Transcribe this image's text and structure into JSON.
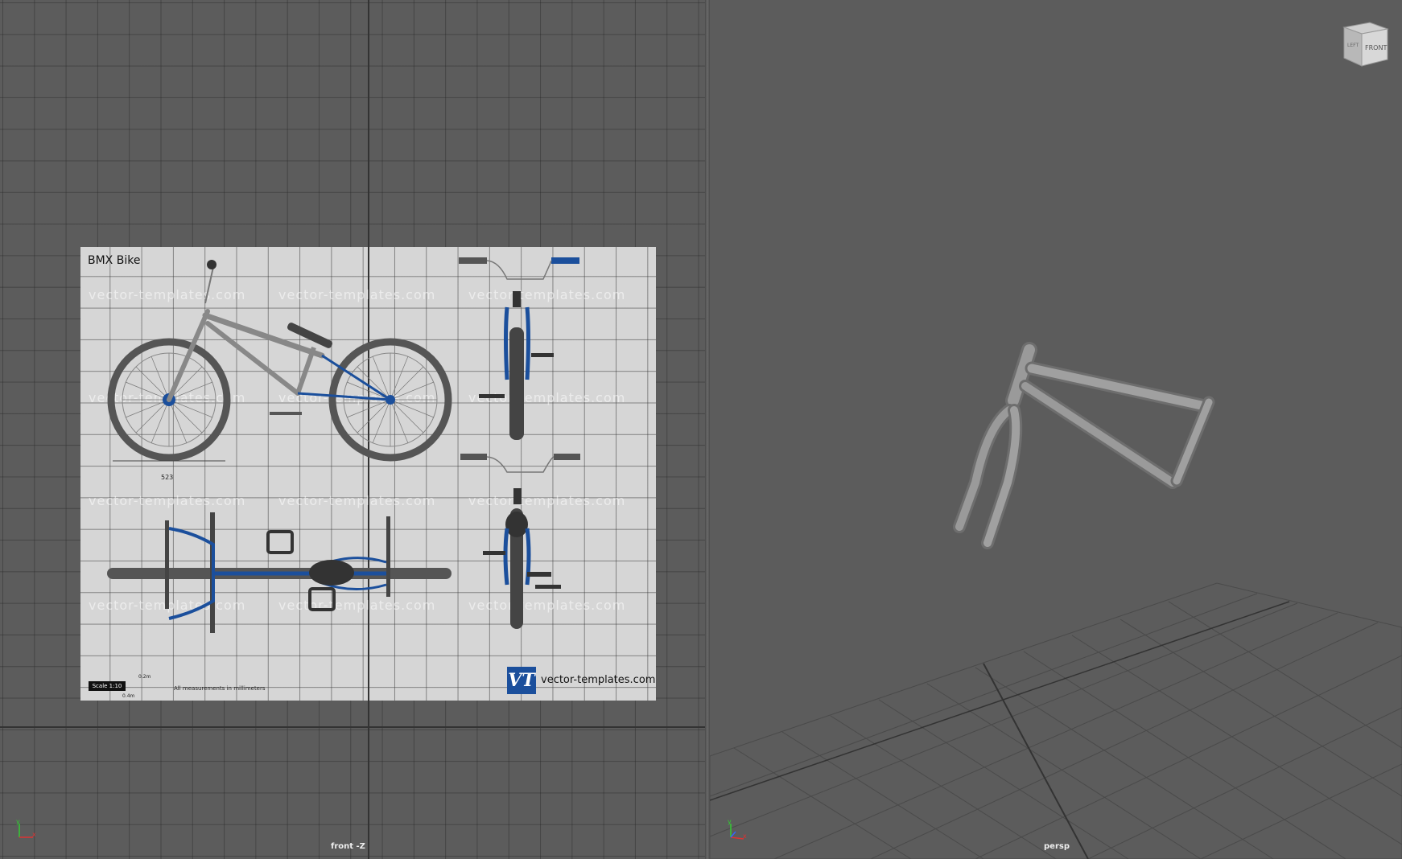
{
  "front_viewport": {
    "label": "front -Z",
    "blueprint": {
      "title": "BMX Bike",
      "watermark_text": "vector-templates.com",
      "dimension": "523",
      "scale_label": "Scale 1:10",
      "scale_units_top": "0.2m",
      "scale_units_bottom": "0.4m",
      "measurement_note": "All measurements in millimeters",
      "logo_letters": "VT",
      "logo_text": "vector-templates.com"
    },
    "axis": {
      "y": "y",
      "x": "x"
    }
  },
  "persp_viewport": {
    "label": "persp",
    "viewcube": {
      "left": "LEFT",
      "front": "FRONT"
    },
    "axis": {
      "y": "y",
      "x": "x"
    }
  },
  "colors": {
    "viewport_bg": "#5c5c5c",
    "blueprint_bg": "#d6d6d6",
    "bike_blue": "#1b4f9c",
    "frame_gray": "#8a8a8a"
  }
}
